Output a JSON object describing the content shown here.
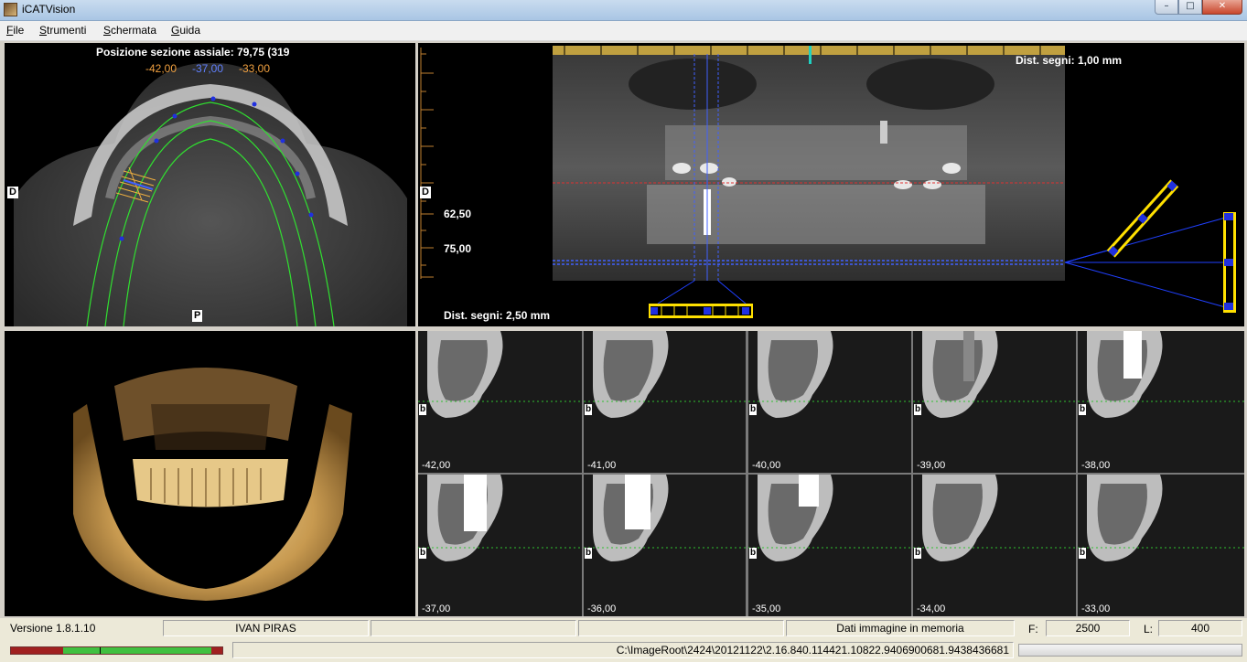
{
  "window": {
    "title": "iCATVision"
  },
  "menu": [
    {
      "label_u": "F",
      "label_rest": "ile"
    },
    {
      "label_u": "S",
      "label_rest": "trumenti"
    },
    {
      "label_u": "S",
      "label_rest": "chermata"
    },
    {
      "label_u": "G",
      "label_rest": "uida"
    }
  ],
  "axial": {
    "position_label": "Posizione sezione assiale: 79,75 (319",
    "coord_1": "-42,00",
    "coord_2": "-37,00",
    "coord_3": "-33,00",
    "marker_left": "D",
    "marker_bottom": "P",
    "colors": {
      "coord_1": "#f0a040",
      "coord_2": "#6080ff",
      "coord_3": "#f0a040"
    }
  },
  "panoramic": {
    "dist_top": "Dist. segni: 1,00 mm",
    "dist_bottom": "Dist. segni: 2,50 mm",
    "ruler_val_1": "62,50",
    "ruler_val_2": "75,00",
    "marker_left": "D"
  },
  "cross_sections": [
    {
      "value": "-42,00",
      "marker": "b"
    },
    {
      "value": "-41,00",
      "marker": "b"
    },
    {
      "value": "-40,00",
      "marker": "b"
    },
    {
      "value": "-39,00",
      "marker": "b"
    },
    {
      "value": "-38,00",
      "marker": "b"
    },
    {
      "value": "-37,00",
      "marker": "b"
    },
    {
      "value": "-36,00",
      "marker": "b"
    },
    {
      "value": "-35,00",
      "marker": "b"
    },
    {
      "value": "-34,00",
      "marker": "b"
    },
    {
      "value": "-33,00",
      "marker": "b"
    }
  ],
  "status": {
    "version": "Versione 1.8.1.10",
    "patient": "IVAN PIRAS",
    "empty_1": "",
    "empty_2": "",
    "memory": "Dati immagine in memoria",
    "f_label": "F:",
    "f_value": "2500",
    "l_label": "L:",
    "l_value": "400",
    "path": "C:\\ImageRoot\\2424\\20121122\\2.16.840.114421.10822.9406900681.9438436681"
  }
}
